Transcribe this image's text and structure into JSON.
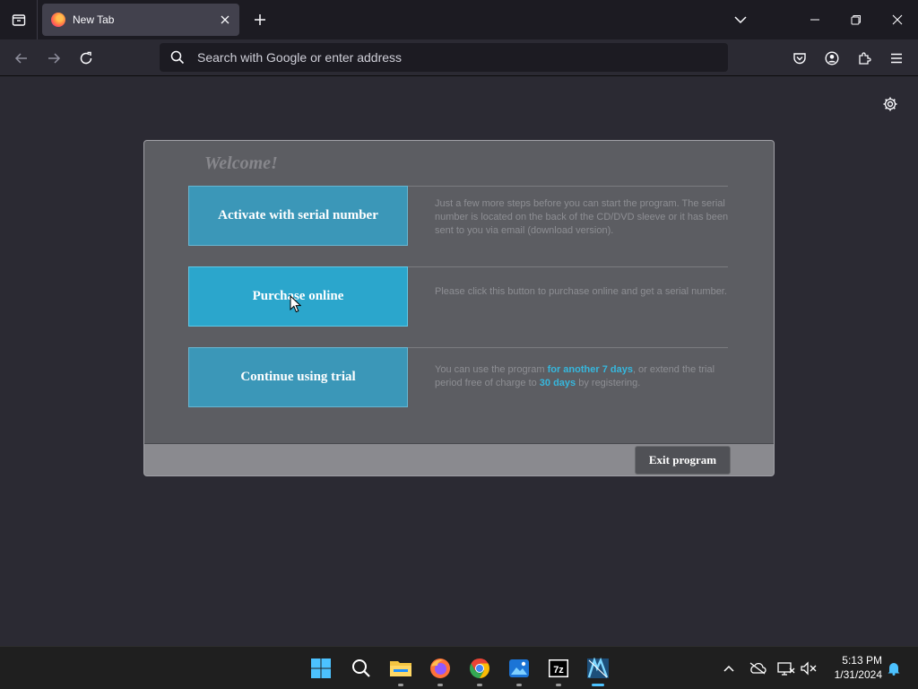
{
  "browser": {
    "tab": {
      "title": "New Tab"
    },
    "address_bar": {
      "placeholder": "Search with Google or enter address",
      "value": ""
    }
  },
  "dialog": {
    "heading": "Welcome!",
    "options": [
      {
        "label": "Activate with serial number",
        "description": "Just a few more steps before you can start the program. The serial number is located on the back of the CD/DVD sleeve or it has been sent to you via email (download version)."
      },
      {
        "label": "Purchase online",
        "description": "Please click this button to purchase online and get a serial number."
      },
      {
        "label": "Continue using trial",
        "description_parts": [
          "You can use the program ",
          "for another 7 days",
          ", or extend the trial period free of charge to ",
          "30 days",
          " by registering."
        ]
      }
    ],
    "exit_label": "Exit program"
  },
  "taskbar": {
    "apps": [
      "start-icon",
      "search-icon",
      "file-explorer-icon",
      "firefox-icon",
      "chrome-icon",
      "photos-icon",
      "7zip-icon",
      "app-icon"
    ],
    "zip_label": "7z",
    "time": "5:13 PM",
    "date": "1/31/2024"
  },
  "colors": {
    "accent": "#3b97b8",
    "highlight": "#36b7dd",
    "page_bg": "#2b2a33"
  }
}
